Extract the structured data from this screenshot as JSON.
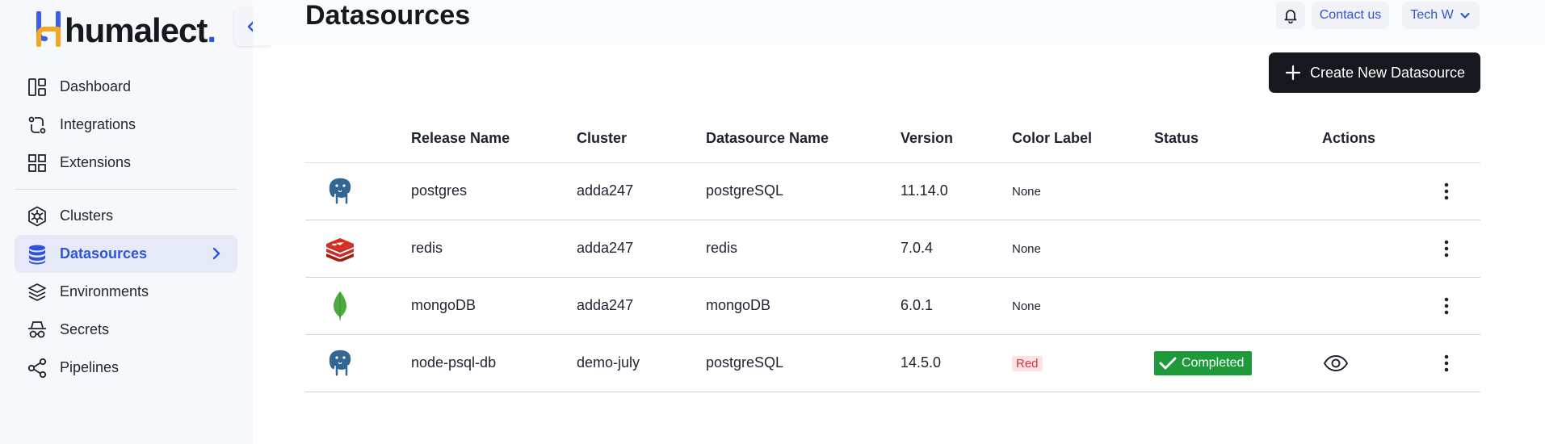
{
  "brand": {
    "name": "humalect",
    "dot": "."
  },
  "header": {
    "title": "Datasources",
    "contact": "Contact us",
    "user": "Tech W"
  },
  "sidebar": {
    "items": [
      {
        "label": "Dashboard",
        "icon": "dashboard-icon"
      },
      {
        "label": "Integrations",
        "icon": "integrations-icon"
      },
      {
        "label": "Extensions",
        "icon": "extensions-icon"
      },
      {
        "label": "Clusters",
        "icon": "clusters-icon"
      },
      {
        "label": "Datasources",
        "icon": "database-icon",
        "active": true
      },
      {
        "label": "Environments",
        "icon": "layers-icon"
      },
      {
        "label": "Secrets",
        "icon": "spy-icon"
      },
      {
        "label": "Pipelines",
        "icon": "share-icon"
      }
    ]
  },
  "toolbar": {
    "create_label": "Create New Datasource"
  },
  "table": {
    "columns": [
      "Release Name",
      "Cluster",
      "Datasource Name",
      "Version",
      "Color Label",
      "Status",
      "Actions"
    ],
    "rows": [
      {
        "logo": "postgres-logo",
        "release": "postgres",
        "cluster": "adda247",
        "datasource": "postgreSQL",
        "version": "11.14.0",
        "color_label": "None",
        "status": ""
      },
      {
        "logo": "redis-logo",
        "release": "redis",
        "cluster": "adda247",
        "datasource": "redis",
        "version": "7.0.4",
        "color_label": "None",
        "status": ""
      },
      {
        "logo": "mongodb-logo",
        "release": "mongoDB",
        "cluster": "adda247",
        "datasource": "mongoDB",
        "version": "6.0.1",
        "color_label": "None",
        "status": ""
      },
      {
        "logo": "postgres-logo",
        "release": "node-psql-db",
        "cluster": "demo-july",
        "datasource": "postgreSQL",
        "version": "14.5.0",
        "color_label": "Red",
        "status": "Completed"
      }
    ]
  },
  "colors": {
    "accent": "#2f54d9",
    "dark": "#16181f",
    "success": "#1e9a3b",
    "danger": "#d4353b"
  }
}
